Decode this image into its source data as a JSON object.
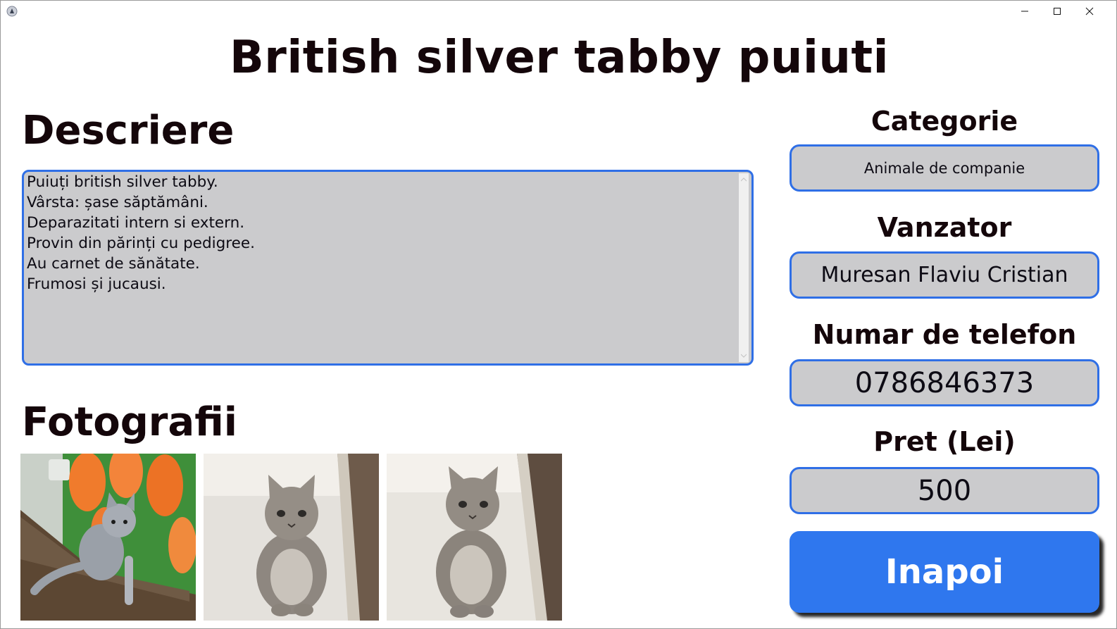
{
  "window": {
    "controls": [
      "minimize-icon",
      "maximize-icon",
      "close-icon"
    ]
  },
  "page": {
    "title": "British silver tabby puiuti"
  },
  "description": {
    "heading": "Descriere",
    "text": "Puiuți british silver tabby.\nVârsta: șase săptămâni.\nDeparazitati intern si extern.\nProvin din părinți cu pedigree.\nAu carnet de sănătate.\nFrumosi și jucausi."
  },
  "photos": {
    "heading": "Fotografii",
    "items": [
      "kitten-photo-1",
      "kitten-photo-2",
      "kitten-photo-3"
    ]
  },
  "details": {
    "category": {
      "label": "Categorie",
      "value": "Animale de companie"
    },
    "seller": {
      "label": "Vanzator",
      "value": "Muresan Flaviu Cristian"
    },
    "phone": {
      "label": "Numar de telefon",
      "value": "0786846373"
    },
    "price": {
      "label": "Pret (Lei)",
      "value": "500"
    }
  },
  "actions": {
    "back_label": "Inapoi"
  },
  "colors": {
    "accent": "#2f6fe6",
    "button": "#2f77ee",
    "field_bg": "#cbcbcd",
    "text": "#14060a"
  }
}
